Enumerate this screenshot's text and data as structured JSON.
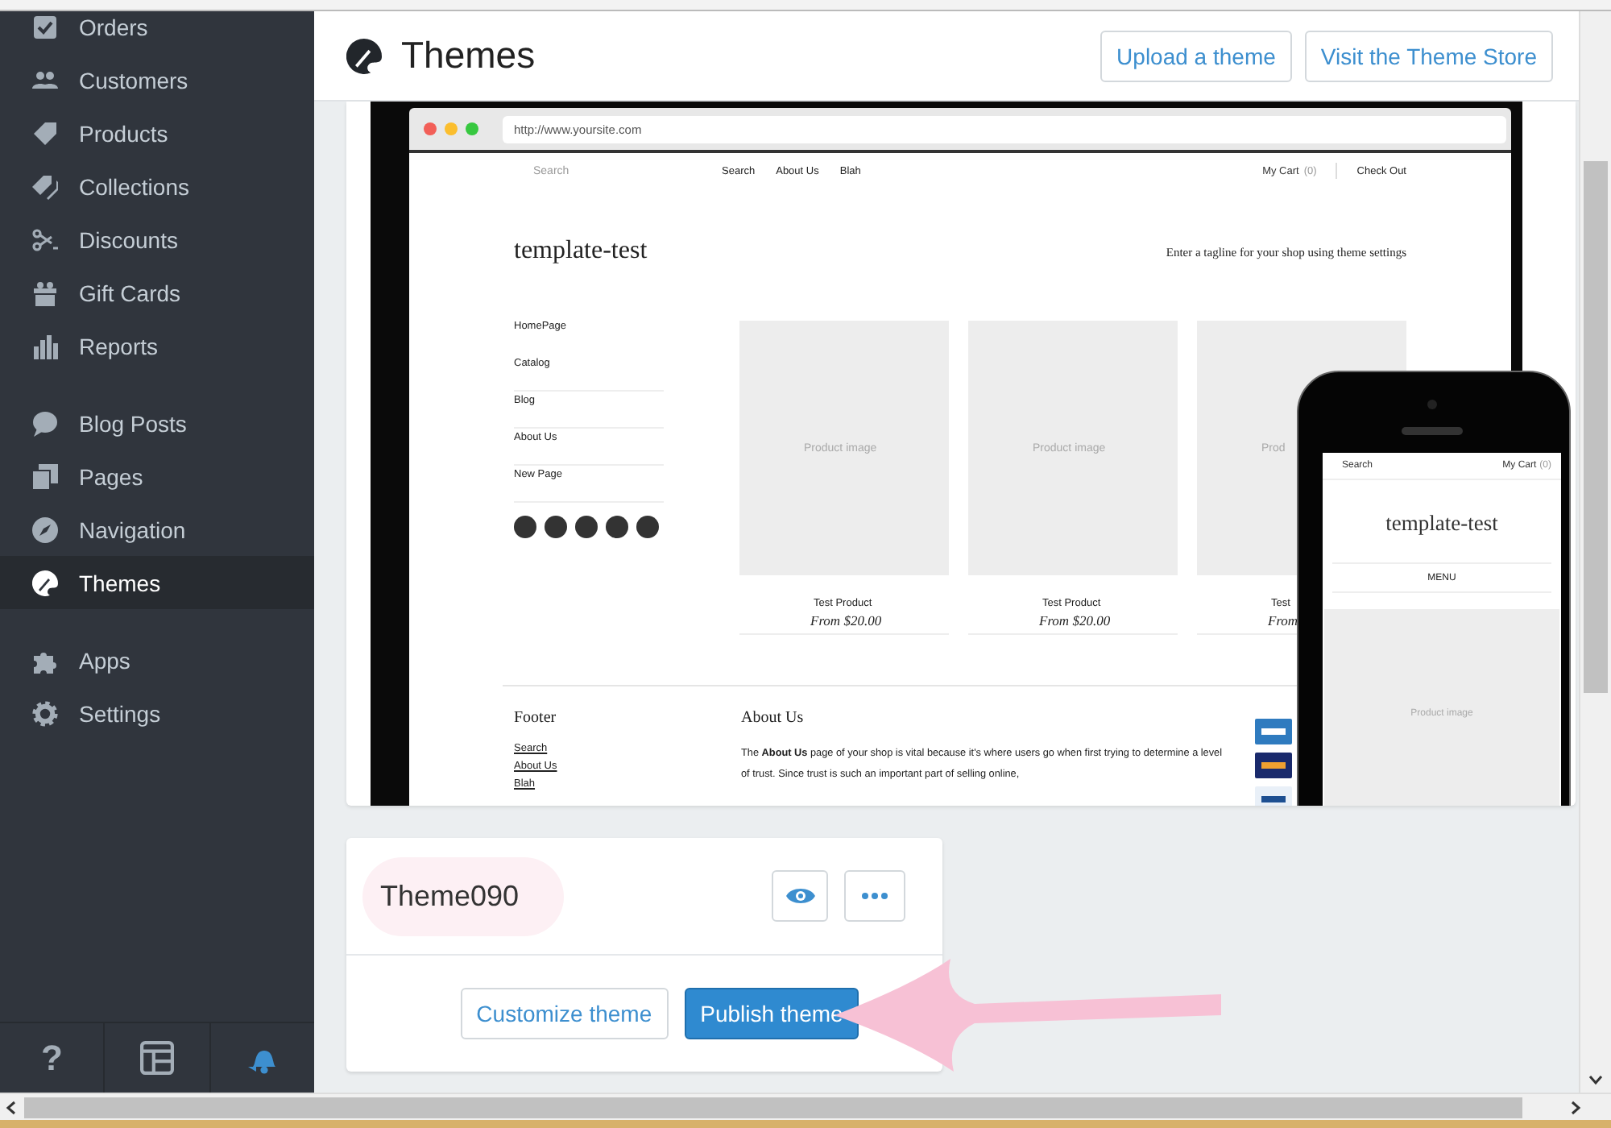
{
  "sidebar": {
    "groups": [
      {
        "items": [
          {
            "label": "Orders",
            "selected": false
          },
          {
            "label": "Customers",
            "selected": false
          },
          {
            "label": "Products",
            "selected": false
          },
          {
            "label": "Collections",
            "selected": false
          },
          {
            "label": "Discounts",
            "selected": false
          },
          {
            "label": "Gift Cards",
            "selected": false
          },
          {
            "label": "Reports",
            "selected": false
          }
        ]
      },
      {
        "items": [
          {
            "label": "Blog Posts",
            "selected": false
          },
          {
            "label": "Pages",
            "selected": false
          },
          {
            "label": "Navigation",
            "selected": false
          },
          {
            "label": "Themes",
            "selected": true
          }
        ]
      },
      {
        "items": [
          {
            "label": "Apps",
            "selected": false
          },
          {
            "label": "Settings",
            "selected": false
          }
        ]
      }
    ],
    "footer": {
      "help": "?"
    }
  },
  "header": {
    "title": "Themes",
    "buttons": [
      "Upload a theme",
      "Visit the Theme Store"
    ]
  },
  "preview": {
    "url": "http://www.yoursite.com",
    "site": {
      "search_placeholder": "Search",
      "nav": [
        "Search",
        "About Us",
        "Blah"
      ],
      "cart": "My Cart",
      "cart_count": "(0)",
      "checkout": "Check Out",
      "logo": "template-test",
      "tagline": "Enter a tagline for your shop using theme settings",
      "menu": [
        "HomePage",
        "Catalog",
        "Blog",
        "About Us",
        "New Page"
      ],
      "products": [
        {
          "image_label": "Product image",
          "name": "Test Product",
          "price": "From $20.00"
        },
        {
          "image_label": "Product image",
          "name": "Test Product",
          "price": "From $20.00"
        },
        {
          "image_label": "Prod",
          "name": "Test",
          "price": "From"
        }
      ],
      "footer": {
        "title": "Footer",
        "links": [
          "Search",
          "About Us",
          "Blah"
        ],
        "about_title": "About Us",
        "about_text": "The **About Us** page of your shop is vital because it's where users go when first trying to determine a level of trust. Since trust is such an important part of selling online,"
      }
    },
    "phone": {
      "search": "Search",
      "cart": "My Cart",
      "cart_count": "(0)",
      "logo": "template-test",
      "menu": "MENU",
      "image_label": "Product image"
    }
  },
  "theme": {
    "name": "Theme090",
    "highlighted": true,
    "buttons": [
      {
        "label": "Customize theme",
        "kind": "secondary"
      },
      {
        "label": "Publish theme",
        "kind": "primary"
      }
    ]
  },
  "annotation": {
    "kind": "arrow"
  }
}
